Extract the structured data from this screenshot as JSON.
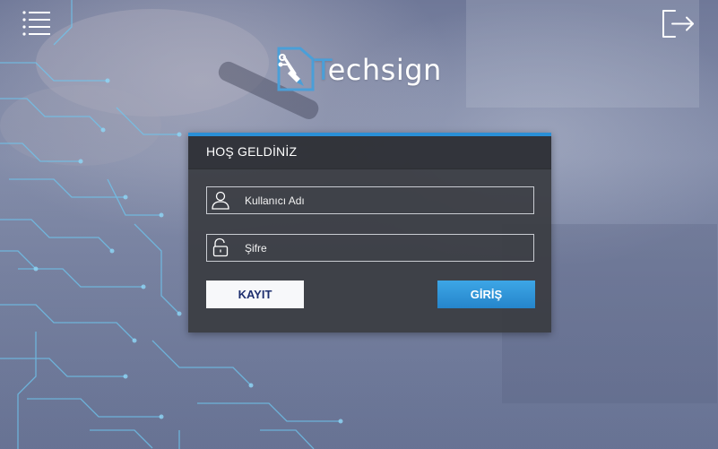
{
  "header": {
    "menu_icon": "hamburger-list-icon",
    "logout_icon": "logout-arrow-icon"
  },
  "brand": {
    "logo_icon": "circuit-pen-logo-icon",
    "name_first": "T",
    "name_rest": "echsign",
    "accent_color": "#2a8fd6"
  },
  "login": {
    "title": "HOŞ GELDİNİZ",
    "username": {
      "placeholder": "Kullanıcı Adı",
      "value": "",
      "icon": "user-icon"
    },
    "password": {
      "placeholder": "Şifre",
      "value": "",
      "icon": "lock-icon"
    },
    "register_label": "KAYIT",
    "submit_label": "GİRİŞ"
  },
  "colors": {
    "panel": "#3a3c42",
    "primary_button": "#2a8fd6",
    "secondary_button": "#f7f8fa",
    "secondary_button_text": "#1e2f6f"
  }
}
